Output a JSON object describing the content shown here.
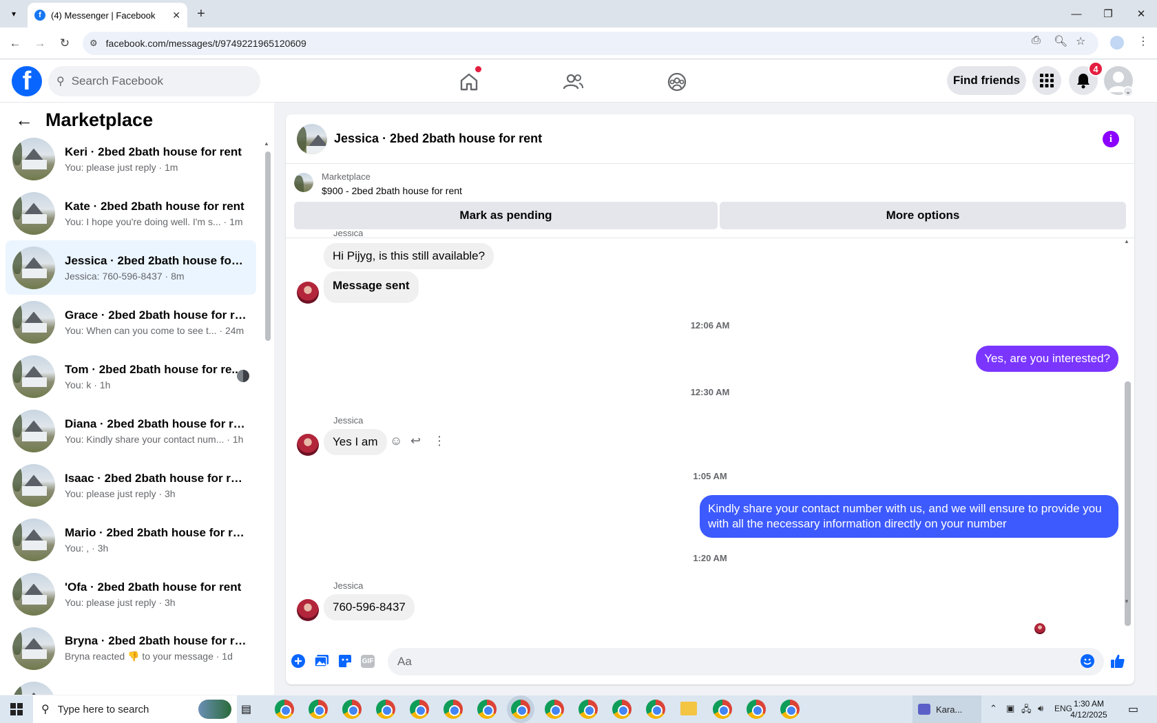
{
  "browser": {
    "tab_title": "(4) Messenger | Facebook",
    "url": "facebook.com/messages/t/9749221965120609"
  },
  "fb": {
    "search_placeholder": "Search Facebook",
    "find_friends": "Find friends",
    "notif_count": "4"
  },
  "sidebar": {
    "title": "Marketplace",
    "conversations": [
      {
        "name": "Keri · 2bed 2bath house for rent",
        "preview": "You: please just reply · 1m"
      },
      {
        "name": "Kate · 2bed 2bath house for rent",
        "preview": "You: I hope you're doing well. I'm s... · 1m"
      },
      {
        "name": "Jessica · 2bed 2bath house for re...",
        "preview": "Jessica: 760-596-8437 · 8m"
      },
      {
        "name": "Grace · 2bed 2bath house for rent",
        "preview": "You: When can you come to see t... · 24m"
      },
      {
        "name": "Tom · 2bed 2bath house for re...",
        "preview": "You: k · 1h"
      },
      {
        "name": "Diana · 2bed 2bath house for rent",
        "preview": "You: Kindly share your contact num... · 1h"
      },
      {
        "name": "Isaac · 2bed 2bath house for rent",
        "preview": "You: please just reply · 3h"
      },
      {
        "name": "Mario · 2bed 2bath house for rent",
        "preview": "You: , · 3h"
      },
      {
        "name": "'Ofa · 2bed 2bath house for rent",
        "preview": "You: please just reply · 3h"
      },
      {
        "name": "Bryna · 2bed 2bath house for rent",
        "preview": "Bryna reacted 👎 to your message · 1d"
      }
    ]
  },
  "chat": {
    "title": "Jessica · 2bed 2bath house for rent",
    "marketplace_label": "Marketplace",
    "listing": "$900 - 2bed 2bath house for rent",
    "mark_pending": "Mark as pending",
    "more_options": "More options",
    "sender_partial": "Jessica",
    "msg1": "Hi Pijyg, is this still available?",
    "msg2": "Message sent",
    "ts1": "12:06 AM",
    "msg3": "Yes, are you interested?",
    "ts2": "12:30 AM",
    "sender2": "Jessica",
    "msg4": "Yes I am",
    "ts3": "1:05 AM",
    "msg5": "Kindly share your contact number with us, and we will ensure to provide you with all the necessary information directly on your number",
    "ts4": "1:20 AM",
    "sender3": "Jessica",
    "msg6": "760-596-8437",
    "input_placeholder": "Aa",
    "info_glyph": "i",
    "gif_label": "GIF"
  },
  "taskbar": {
    "search_placeholder": "Type here to search",
    "app_label": "Kara...",
    "lang": "ENG",
    "time": "1:30 AM",
    "date": "4/12/2025"
  }
}
